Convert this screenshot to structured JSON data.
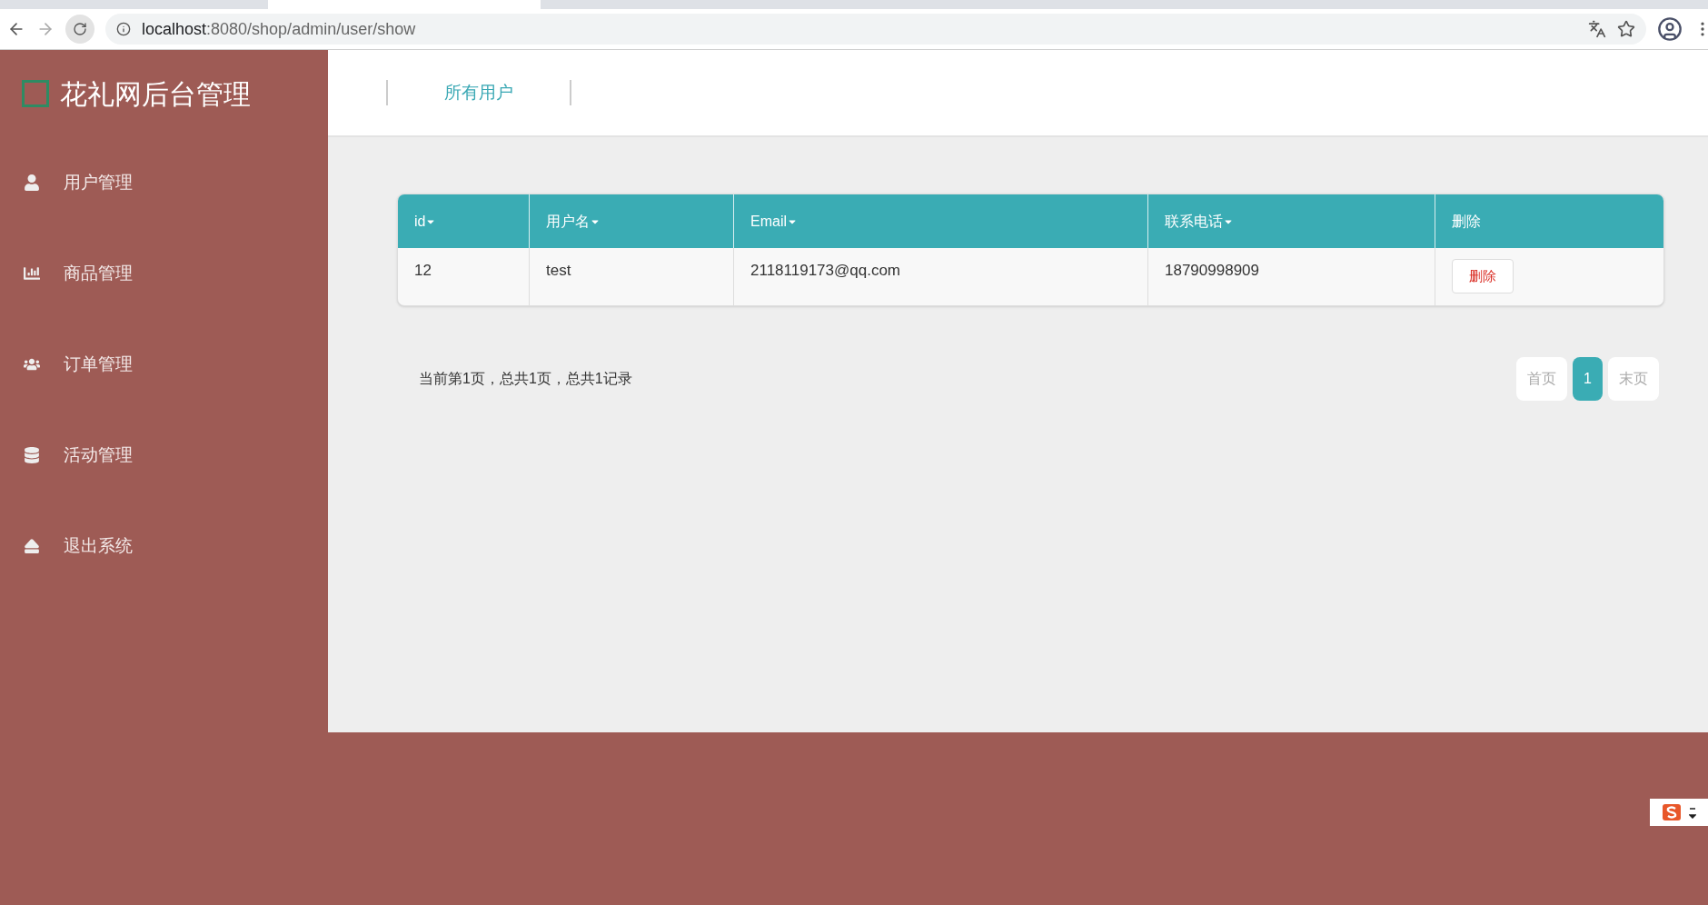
{
  "browser": {
    "url_host": "localhost",
    "url_rest": ":8080/shop/admin/user/show"
  },
  "sidebar": {
    "title": "花礼网后台管理",
    "items": [
      {
        "label": "用户管理",
        "kind": "user"
      },
      {
        "label": "商品管理",
        "kind": "chart"
      },
      {
        "label": "订单管理",
        "kind": "users"
      },
      {
        "label": "活动管理",
        "kind": "database"
      },
      {
        "label": "退出系统",
        "kind": "eject"
      }
    ]
  },
  "header": {
    "tabs": [
      {
        "label": "所有用户",
        "selected": true
      }
    ]
  },
  "table": {
    "columns": [
      {
        "label": "id",
        "sortable": true
      },
      {
        "label": "用户名",
        "sortable": true
      },
      {
        "label": "Email",
        "sortable": true
      },
      {
        "label": "联系电话",
        "sortable": true
      },
      {
        "label": "删除",
        "sortable": false
      }
    ],
    "rows": [
      {
        "cells": [
          "12",
          "test",
          "2118119173@qq.com",
          "18790998909"
        ],
        "action": "删除"
      }
    ]
  },
  "pagination": {
    "summary": "当前第1页，总共1页，总共1记录",
    "buttons": [
      {
        "label": "首页",
        "selected": false
      },
      {
        "label": "1",
        "selected": true
      },
      {
        "label": "末页",
        "selected": false
      }
    ]
  }
}
